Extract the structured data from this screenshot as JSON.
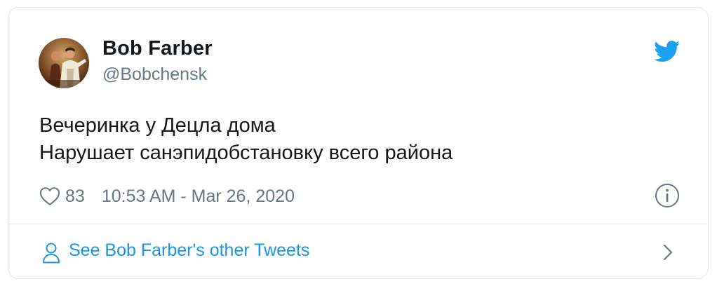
{
  "author": {
    "name": "Bob Farber",
    "handle": "@Bobchensk",
    "avatar_icon": "avatar-photo"
  },
  "tweet": {
    "lines": [
      "Вечеринка у Децла дома",
      "Нарушает санэпидобстановку всего района"
    ],
    "likes": "83",
    "timestamp": "10:53 AM - Mar 26, 2020"
  },
  "footer": {
    "label": "See Bob Farber's other Tweets"
  },
  "icons": {
    "brand": "twitter-bird-icon",
    "like": "heart-icon",
    "info": "info-icon",
    "profile": "person-icon",
    "more": "chevron-right-icon"
  },
  "colors": {
    "brand_blue": "#1da1f2",
    "link_blue": "#1b95e0",
    "text_primary": "#14171a",
    "text_secondary": "#657786",
    "border": "#e1e8ed"
  }
}
